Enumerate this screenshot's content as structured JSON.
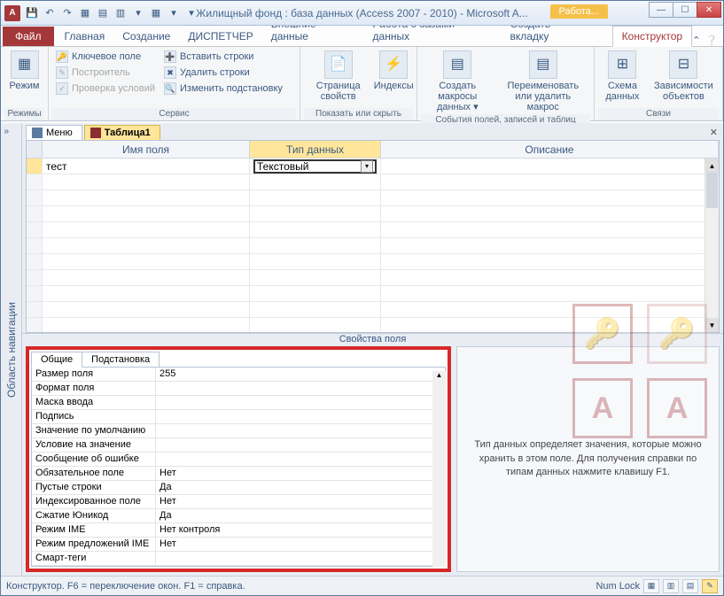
{
  "window": {
    "title": "Жилищный фонд : база данных (Access 2007 - 2010)  -  Microsoft A...",
    "context_label": "Работа..."
  },
  "ribbon_tabs": {
    "file": "Файл",
    "home": "Главная",
    "create": "Создание",
    "dispatcher": "ДИСПЕТЧЕР",
    "external": "Внешние данные",
    "dbtools": "Работа с базами данных",
    "newtab": "Создать вкладку",
    "design": "Конструктор"
  },
  "ribbon": {
    "views": {
      "mode": "Режим",
      "label": "Режимы"
    },
    "tools": {
      "key": "Ключевое поле",
      "builder": "Построитель",
      "test": "Проверка условий",
      "insert": "Вставить строки",
      "delete": "Удалить строки",
      "modify": "Изменить подстановку",
      "label": "Сервис"
    },
    "showhide": {
      "propsheet": "Страница свойств",
      "indexes": "Индексы",
      "label": "Показать или скрыть"
    },
    "events": {
      "datamacros": "Создать макросы данных ▾",
      "rename": "Переименовать или удалить макрос",
      "label": "События полей, записей и таблиц"
    },
    "rel": {
      "schema": "Схема данных",
      "deps": "Зависимости объектов",
      "label": "Связи"
    }
  },
  "nav_label": "Область навигации",
  "doc_tabs": {
    "menu": "Меню",
    "table": "Таблица1"
  },
  "grid": {
    "hname": "Имя поля",
    "htype": "Тип данных",
    "hdesc": "Описание",
    "row1_name": "тест",
    "row1_type": "Текстовый"
  },
  "props_title": "Свойства поля",
  "prop_tabs": {
    "general": "Общие",
    "lookup": "Подстановка"
  },
  "props": [
    {
      "label": "Размер поля",
      "value": "255"
    },
    {
      "label": "Формат поля",
      "value": ""
    },
    {
      "label": "Маска ввода",
      "value": ""
    },
    {
      "label": "Подпись",
      "value": ""
    },
    {
      "label": "Значение по умолчанию",
      "value": ""
    },
    {
      "label": "Условие на значение",
      "value": ""
    },
    {
      "label": "Сообщение об ошибке",
      "value": ""
    },
    {
      "label": "Обязательное поле",
      "value": "Нет"
    },
    {
      "label": "Пустые строки",
      "value": "Да"
    },
    {
      "label": "Индексированное поле",
      "value": "Нет"
    },
    {
      "label": "Сжатие Юникод",
      "value": "Да"
    },
    {
      "label": "Режим IME",
      "value": "Нет контроля"
    },
    {
      "label": "Режим предложений IME",
      "value": "Нет"
    },
    {
      "label": "Смарт-теги",
      "value": ""
    }
  ],
  "hint": "Тип данных определяет значения, которые можно хранить в этом поле. Для получения справки по типам данных нажмите клавишу F1.",
  "status": {
    "left": "Конструктор.  F6 = переключение окон.  F1 = справка.",
    "numlock": "Num Lock"
  }
}
